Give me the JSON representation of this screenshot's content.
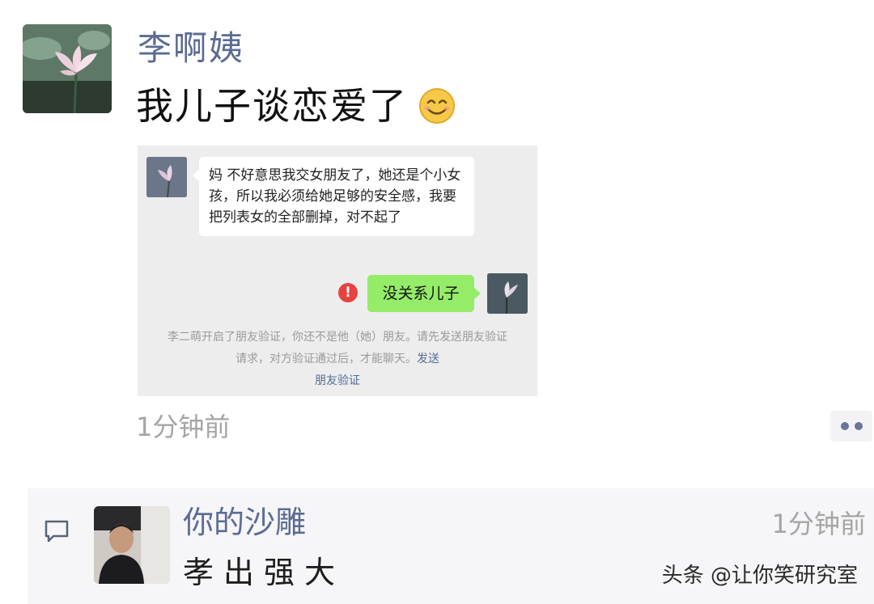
{
  "post": {
    "author": "李啊姨",
    "content": "我儿子谈恋爱了",
    "content_emoji_icon": "smile-emoji-icon",
    "time": "1分钟前",
    "more_icon": "more-dots-icon"
  },
  "screenshot": {
    "incoming_message": "妈  不好意思我交女朋友了，她还是个小女孩，所以我必须给她足够的安全感，我要把列表女的全部删掉，对不起了",
    "outgoing_message": "没关系儿子",
    "failed_icon": "exclamation-icon",
    "system_message": "李二萌开启了朋友验证，你还不是他（她）朋友。请先发送朋友验证请求，对方验证通过后，才能聊天。",
    "system_link_1": "发送",
    "system_link_2": "朋友验证"
  },
  "comment": {
    "icon": "comment-icon",
    "author": "你的沙雕",
    "text": "孝出强大",
    "time": "1分钟前"
  },
  "watermark": "头条 @让你笑研究室",
  "colors": {
    "name_blue": "#5b6b93",
    "wechat_green": "#95ec69",
    "error_red": "#e64340"
  }
}
